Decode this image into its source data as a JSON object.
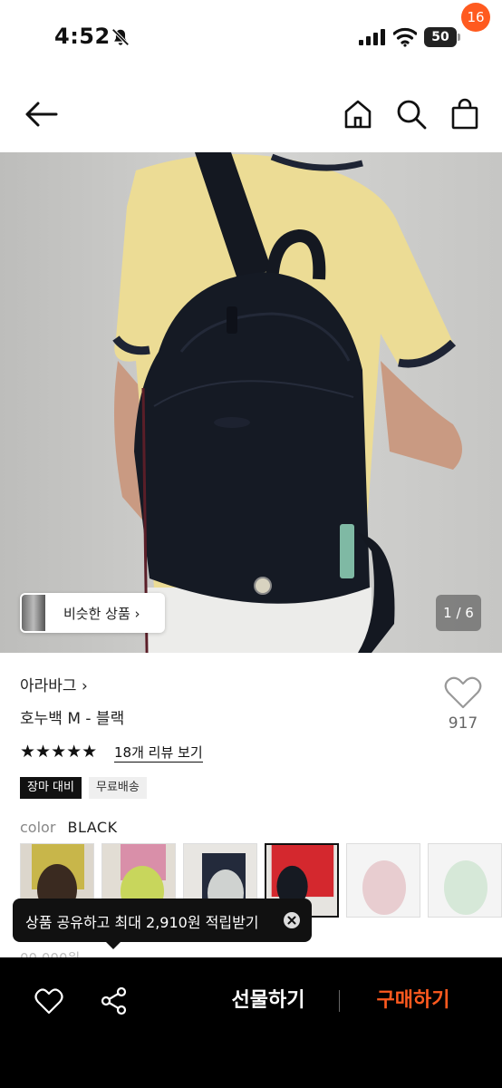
{
  "status_bar": {
    "time": "4:52",
    "battery": "50"
  },
  "header": {
    "cart_count": "16"
  },
  "hero": {
    "similar_label": "비슷한 상품 ›",
    "page_indicator": "1 / 6"
  },
  "product": {
    "brand": "아라바그 ›",
    "title": "호누백 M - 블랙",
    "like_count": "917",
    "stars": "★★★★★",
    "review_link": "18개 리뷰 보기",
    "badges": [
      "장마 대비",
      "무료배송"
    ],
    "color_label": "color",
    "color_value": "BLACK",
    "price_partial": "00,000원"
  },
  "swatches": [
    {
      "name": "brown-model",
      "selected": false
    },
    {
      "name": "lime-model",
      "selected": false
    },
    {
      "name": "gray-model",
      "selected": false
    },
    {
      "name": "black-model",
      "selected": true
    },
    {
      "name": "pink-bag",
      "selected": false
    },
    {
      "name": "mint-bag",
      "selected": false
    }
  ],
  "toast": {
    "text": "상품 공유하고 최대 2,910원 적립받기"
  },
  "bottom_bar": {
    "gift_label": "선물하기",
    "buy_label": "구매하기"
  },
  "colors": {
    "accent": "#ff5a1f",
    "bar_bg": "#000000"
  }
}
